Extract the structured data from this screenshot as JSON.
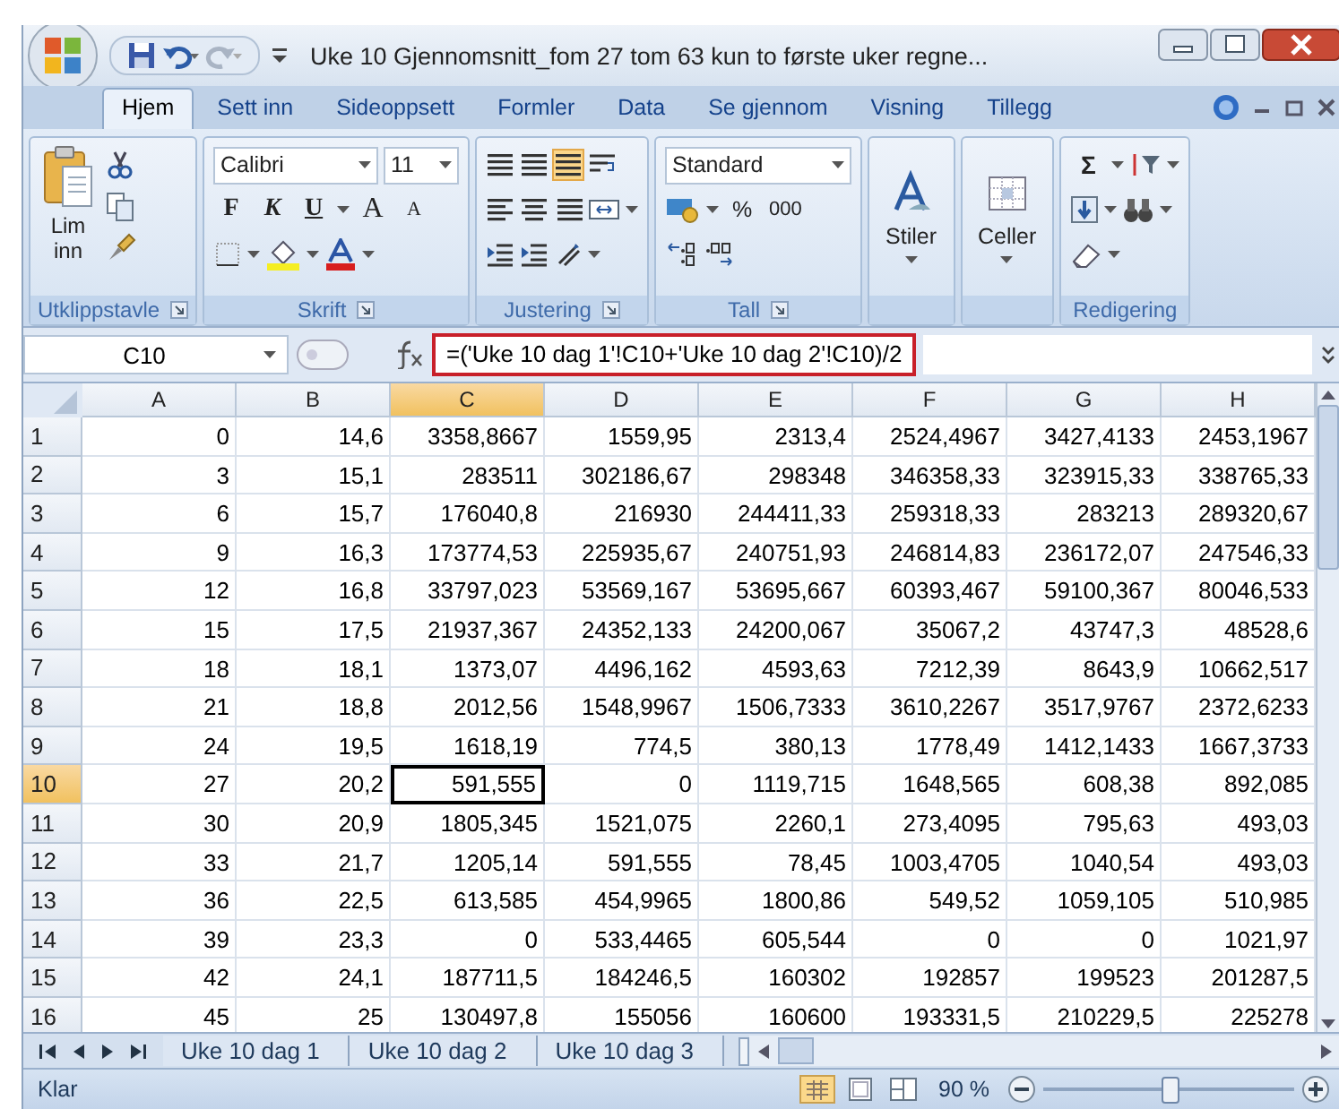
{
  "window": {
    "title": "Uke 10 Gjennomsnitt_fom 27 tom 63 kun to første uker regne..."
  },
  "tabs": [
    {
      "label": "Hjem",
      "selected": true
    },
    {
      "label": "Sett inn",
      "selected": false
    },
    {
      "label": "Sideoppsett",
      "selected": false
    },
    {
      "label": "Formler",
      "selected": false
    },
    {
      "label": "Data",
      "selected": false
    },
    {
      "label": "Se gjennom",
      "selected": false
    },
    {
      "label": "Visning",
      "selected": false
    },
    {
      "label": "Tillegg",
      "selected": false
    }
  ],
  "ribbon": {
    "clipboard": {
      "label": "Utklippstavle",
      "paste": "Lim inn"
    },
    "font": {
      "label": "Skrift",
      "name": "Calibri",
      "size": "11",
      "bold": "F",
      "italic": "K",
      "underline": "U",
      "grow": "A",
      "shrink": "A"
    },
    "alignment": {
      "label": "Justering"
    },
    "number": {
      "label": "Tall",
      "format": "Standard",
      "percent": "%",
      "thousands": "000"
    },
    "styles": {
      "label": "Stiler"
    },
    "cells": {
      "label": "Celler"
    },
    "editing": {
      "label": "Redigering",
      "sum": "Σ"
    }
  },
  "formula_bar": {
    "name_box": "C10",
    "formula": "=('Uke 10 dag 1'!C10+'Uke 10 dag 2'!C10)/2",
    "highlighted": true
  },
  "columns": [
    {
      "label": "A",
      "selected": false
    },
    {
      "label": "B",
      "selected": false
    },
    {
      "label": "C",
      "selected": true
    },
    {
      "label": "D",
      "selected": false
    },
    {
      "label": "E",
      "selected": false
    },
    {
      "label": "F",
      "selected": false
    },
    {
      "label": "G",
      "selected": false
    },
    {
      "label": "H",
      "selected": false
    }
  ],
  "rows": [
    {
      "header": "1",
      "selected": false,
      "cells": [
        "0",
        "14,6",
        "3358,8667",
        "1559,95",
        "2313,4",
        "2524,4967",
        "3427,4133",
        "2453,1967"
      ]
    },
    {
      "header": "2",
      "selected": false,
      "cells": [
        "3",
        "15,1",
        "283511",
        "302186,67",
        "298348",
        "346358,33",
        "323915,33",
        "338765,33"
      ]
    },
    {
      "header": "3",
      "selected": false,
      "cells": [
        "6",
        "15,7",
        "176040,8",
        "216930",
        "244411,33",
        "259318,33",
        "283213",
        "289320,67"
      ]
    },
    {
      "header": "4",
      "selected": false,
      "cells": [
        "9",
        "16,3",
        "173774,53",
        "225935,67",
        "240751,93",
        "246814,83",
        "236172,07",
        "247546,33"
      ]
    },
    {
      "header": "5",
      "selected": false,
      "cells": [
        "12",
        "16,8",
        "33797,023",
        "53569,167",
        "53695,667",
        "60393,467",
        "59100,367",
        "80046,533"
      ]
    },
    {
      "header": "6",
      "selected": false,
      "cells": [
        "15",
        "17,5",
        "21937,367",
        "24352,133",
        "24200,067",
        "35067,2",
        "43747,3",
        "48528,6"
      ]
    },
    {
      "header": "7",
      "selected": false,
      "cells": [
        "18",
        "18,1",
        "1373,07",
        "4496,162",
        "4593,63",
        "7212,39",
        "8643,9",
        "10662,517"
      ]
    },
    {
      "header": "8",
      "selected": false,
      "cells": [
        "21",
        "18,8",
        "2012,56",
        "1548,9967",
        "1506,7333",
        "3610,2267",
        "3517,9767",
        "2372,6233"
      ]
    },
    {
      "header": "9",
      "selected": false,
      "cells": [
        "24",
        "19,5",
        "1618,19",
        "774,5",
        "380,13",
        "1778,49",
        "1412,1433",
        "1667,3733"
      ]
    },
    {
      "header": "10",
      "selected": true,
      "cells": [
        "27",
        "20,2",
        "591,555",
        "0",
        "1119,715",
        "1648,565",
        "608,38",
        "892,085"
      ]
    },
    {
      "header": "11",
      "selected": false,
      "cells": [
        "30",
        "20,9",
        "1805,345",
        "1521,075",
        "2260,1",
        "273,4095",
        "795,63",
        "493,03"
      ]
    },
    {
      "header": "12",
      "selected": false,
      "cells": [
        "33",
        "21,7",
        "1205,14",
        "591,555",
        "78,45",
        "1003,4705",
        "1040,54",
        "493,03"
      ]
    },
    {
      "header": "13",
      "selected": false,
      "cells": [
        "36",
        "22,5",
        "613,585",
        "454,9965",
        "1800,86",
        "549,52",
        "1059,105",
        "510,985"
      ]
    },
    {
      "header": "14",
      "selected": false,
      "cells": [
        "39",
        "23,3",
        "0",
        "533,4465",
        "605,544",
        "0",
        "0",
        "1021,97"
      ]
    },
    {
      "header": "15",
      "selected": false,
      "cells": [
        "42",
        "24,1",
        "187711,5",
        "184246,5",
        "160302",
        "192857",
        "199523",
        "201287,5"
      ]
    },
    {
      "header": "16",
      "selected": false,
      "cells": [
        "45",
        "25",
        "130497,8",
        "155056",
        "160600",
        "193331,5",
        "210229,5",
        "225278"
      ]
    }
  ],
  "sheet_tabs": [
    {
      "label": "Uke 10 dag 1",
      "selected": false
    },
    {
      "label": "Uke 10 dag 2",
      "selected": false
    },
    {
      "label": "Uke 10 dag 3",
      "selected": false
    }
  ],
  "status_bar": {
    "status": "Klar",
    "zoom": "90 %",
    "zoom_slider": {
      "level": 0.5
    }
  }
}
